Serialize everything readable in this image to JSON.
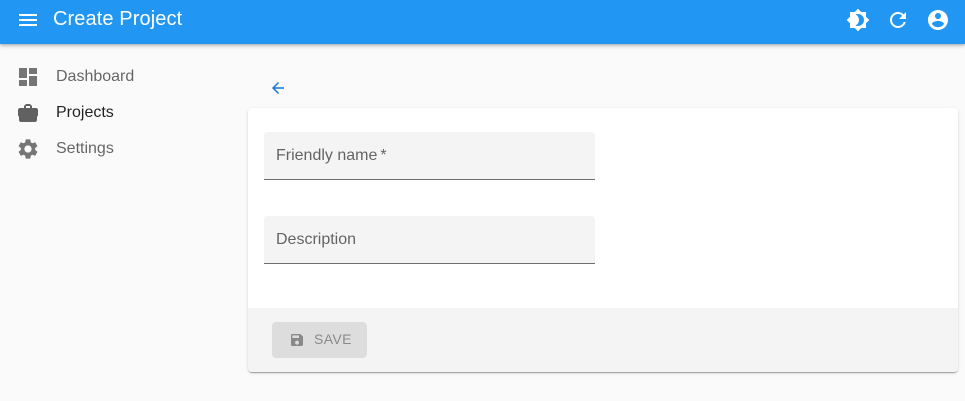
{
  "appbar": {
    "title": "Create Project",
    "menu_icon": "menu-icon",
    "actions": [
      "theme-toggle-icon",
      "refresh-icon",
      "account-circle-icon"
    ],
    "color": "#2196f3"
  },
  "sidebar": {
    "items": [
      {
        "label": "Dashboard",
        "icon": "dashboard-icon"
      },
      {
        "label": "Projects",
        "icon": "briefcase-icon",
        "active": true
      },
      {
        "label": "Settings",
        "icon": "gear-icon"
      }
    ]
  },
  "form": {
    "back_icon": "arrow-back-icon",
    "fields": [
      {
        "label": "Friendly name",
        "required_mark": "*",
        "value": ""
      },
      {
        "label": "Description",
        "value": ""
      }
    ],
    "save_label": "SAVE",
    "save_icon": "floppy-disk-icon",
    "save_disabled": true
  }
}
